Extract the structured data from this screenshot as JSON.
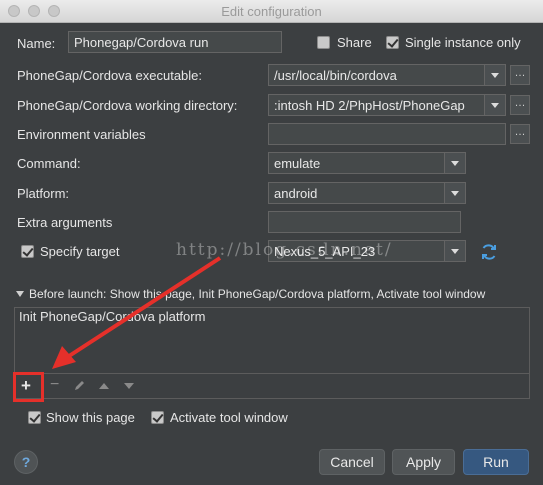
{
  "window": {
    "title": "Edit configuration"
  },
  "name": {
    "label": "Name:",
    "value": "Phonegap/Cordova run"
  },
  "share": {
    "label": "Share",
    "checked": false
  },
  "single_instance": {
    "label": "Single instance only",
    "checked": true
  },
  "executable": {
    "label": "PhoneGap/Cordova executable:",
    "value": "/usr/local/bin/cordova"
  },
  "working_dir": {
    "label": "PhoneGap/Cordova working directory:",
    "value": ":intosh HD 2/PhpHost/PhoneGap"
  },
  "env_vars": {
    "label": "Environment variables",
    "value": ""
  },
  "command": {
    "label": "Command:",
    "value": "emulate"
  },
  "platform": {
    "label": "Platform:",
    "value": "android"
  },
  "extra_args": {
    "label": "Extra arguments",
    "value": ""
  },
  "specify_target": {
    "label": "Specify target",
    "checked": true,
    "value": "Nexus_5_API_23"
  },
  "watermark": "http://blog.csdn.net/",
  "before_launch": {
    "header": "Before launch: Show this page, Init PhoneGap/Cordova platform, Activate tool window",
    "items": [
      "Init PhoneGap/Cordova platform"
    ],
    "toolbar": {
      "add": "+",
      "remove": "−"
    }
  },
  "show_page": {
    "label": "Show this page",
    "checked": true
  },
  "activate_tool": {
    "label": "Activate tool window",
    "checked": true
  },
  "buttons": {
    "help": "?",
    "cancel": "Cancel",
    "apply": "Apply",
    "run": "Run"
  },
  "colors": {
    "annotation_red": "#e5302a",
    "primary_button": "#365880",
    "refresh_icon": "#4a9ee0"
  }
}
